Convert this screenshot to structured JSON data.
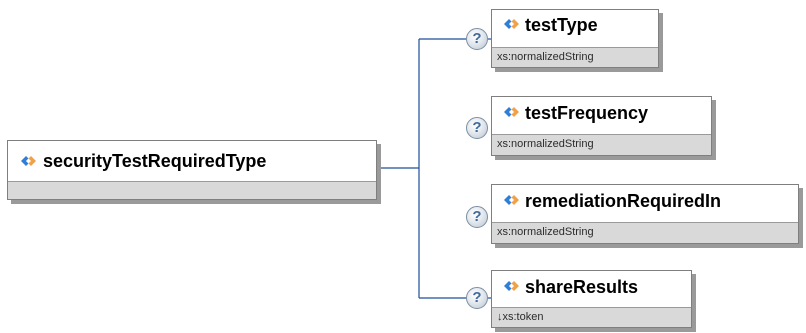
{
  "root": {
    "name": "securityTestRequiredType"
  },
  "children": [
    {
      "name": "testType",
      "type": "xs:normalizedString",
      "help": "?"
    },
    {
      "name": "testFrequency",
      "type": "xs:normalizedString",
      "help": "?"
    },
    {
      "name": "remediationRequiredIn",
      "type": "xs:normalizedString",
      "help": "?"
    },
    {
      "name": "shareResults",
      "type": "↓xs:token",
      "help": "?"
    }
  ],
  "icons": {
    "element": "element-diamond-icon",
    "help": "question-help-icon"
  },
  "colors": {
    "connector": "#1f4e9b",
    "icon_blue": "#2f7fd9",
    "icon_orange": "#f0a24a",
    "type_background": "#d9d9d9",
    "shadow": "#9a9a9a"
  }
}
